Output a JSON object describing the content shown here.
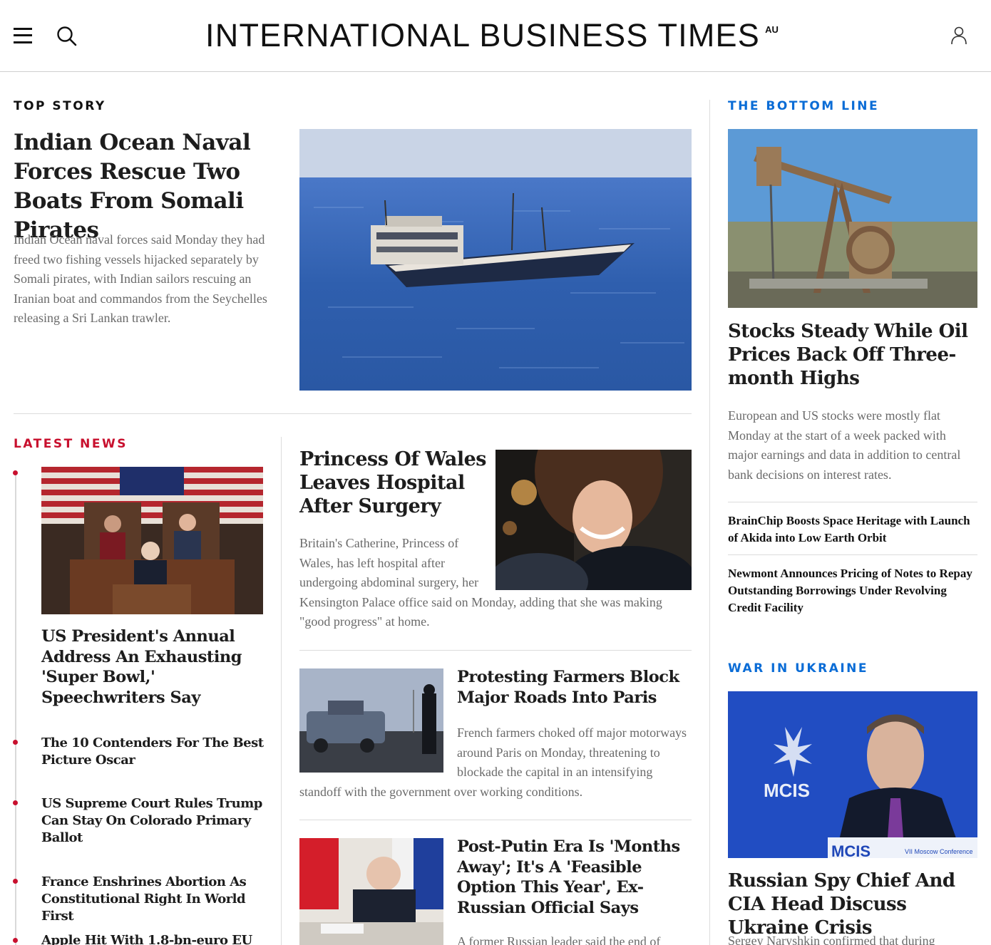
{
  "header": {
    "logo": "INTERNATIONAL BUSINESS TIMES",
    "edition": "AU"
  },
  "top_story": {
    "label": "TOP STORY",
    "title": "Indian Ocean Naval Forces Rescue Two Boats From Somali Pirates",
    "dek": "Indian Ocean naval forces said Monday they had freed two fishing vessels hijacked separately by Somali pirates, with Indian sailors rescuing an Iranian boat and commandos from the Seychelles releasing a Sri Lankan trawler."
  },
  "latest_news": {
    "label": "LATEST NEWS",
    "lead_title": "US President's Annual Address An Exhausting 'Super Bowl,' Speechwriters Say",
    "items": [
      "The 10 Contenders For The Best Picture Oscar",
      "US Supreme Court Rules Trump Can Stay On Colorado Primary Ballot",
      "France Enshrines Abortion As Constitutional Right In World First",
      "Apple Hit With 1.8-bn-euro EU"
    ]
  },
  "middle": {
    "stories": [
      {
        "title": "Princess Of Wales Leaves Hospital After Surgery",
        "dek": "Britain's Catherine, Princess of Wales, has left hospital after undergoing abdominal surgery, her Kensington Palace office said on Monday, adding that she was making \"good progress\" at home."
      },
      {
        "title": "Protesting Farmers Block Major Roads Into Paris",
        "dek": "French farmers choked off major motorways around Paris on Monday, threatening to blockade the capital in an intensifying standoff with the government over working conditions."
      },
      {
        "title": "Post-Putin Era Is 'Months Away'; It's A 'Feasible Option This Year', Ex-Russian Official Says",
        "dek": "A former Russian leader said the end of"
      }
    ]
  },
  "bottom_line": {
    "label": "THE BOTTOM LINE",
    "title": "Stocks Steady While Oil Prices Back Off Three-month Highs",
    "dek": "European and US stocks were mostly flat Monday at the start of a week packed with major earnings and data in addition to central bank decisions on interest rates.",
    "links": [
      "BrainChip Boosts Space Heritage with Launch of Akida into Low Earth Orbit",
      "Newmont Announces Pricing of Notes to Repay Outstanding Borrowings Under Revolving Credit Facility"
    ]
  },
  "war_in_ukraine": {
    "label": "WAR IN UKRAINE",
    "title": "Russian Spy Chief And CIA Head Discuss Ukraine Crisis",
    "dek": "Sergey Naryshkin confirmed that during",
    "image_text": [
      "MCIS",
      "MCIS",
      "VII Moscow Conference"
    ]
  },
  "colors": {
    "latest_accent": "#c8102e",
    "section_blue": "#0a6cd6",
    "headline": "#1d1d1d",
    "dek": "#6a6a6a"
  },
  "icons": [
    "menu-icon",
    "search-icon",
    "user-icon"
  ]
}
